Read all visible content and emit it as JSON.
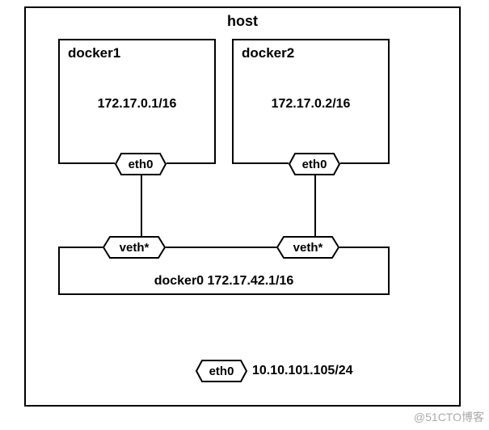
{
  "host": {
    "title": "host",
    "eth_label": "eth0",
    "ip": "10.10.101.105/24"
  },
  "containers": [
    {
      "name": "docker1",
      "ip": "172.17.0.1/16",
      "iface": "eth0"
    },
    {
      "name": "docker2",
      "ip": "172.17.0.2/16",
      "iface": "eth0"
    }
  ],
  "bridge": {
    "label": "docker0 172.17.42.1/16",
    "veth_label": "veth*"
  },
  "watermark": "@51CTO博客"
}
